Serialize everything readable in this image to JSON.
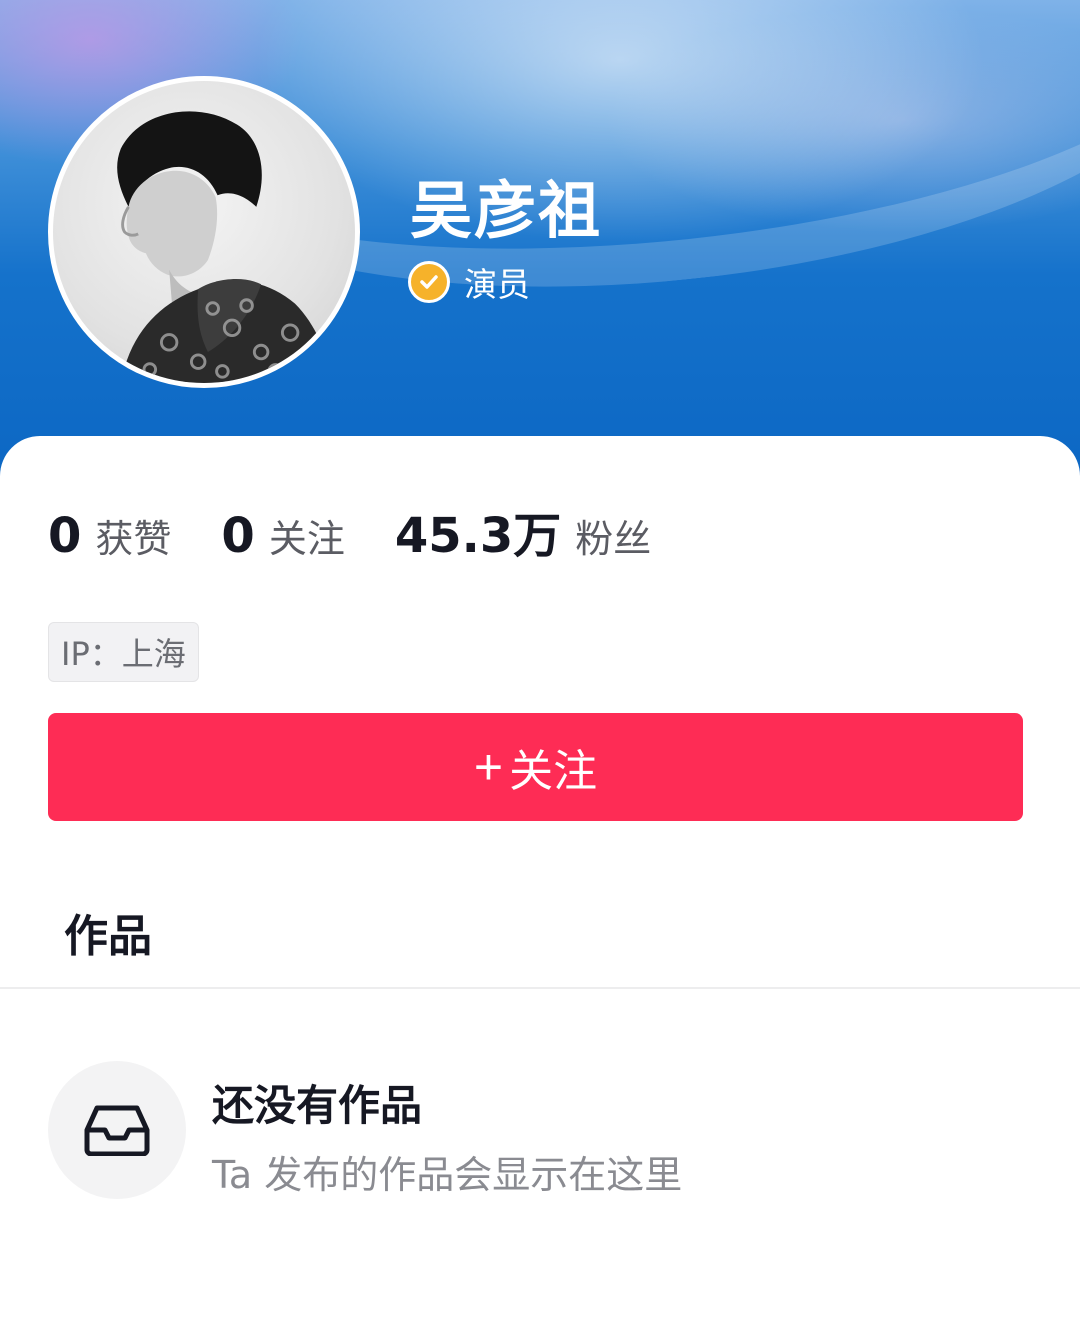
{
  "profile": {
    "name": "吴彦祖",
    "verify_label": "演员",
    "verify_icon": "verified-check-icon",
    "avatar": "avatar-photo"
  },
  "stats": [
    {
      "value": "0",
      "label": "获赞"
    },
    {
      "value": "0",
      "label": "关注"
    },
    {
      "value": "45.3万",
      "label": "粉丝"
    }
  ],
  "ip": "IP：上海",
  "follow_button": {
    "plus": "+",
    "label": "关注"
  },
  "tabs": [
    {
      "label": "作品"
    }
  ],
  "empty_state": {
    "icon": "inbox-tray-icon",
    "title": "还没有作品",
    "subtitle": "Ta 发布的作品会显示在这里"
  },
  "colors": {
    "accent": "#fe2c55",
    "header_blue": "#0b66c3",
    "verify": "#f6b22a",
    "text_primary": "#161823",
    "text_secondary": "#8a8b91"
  }
}
